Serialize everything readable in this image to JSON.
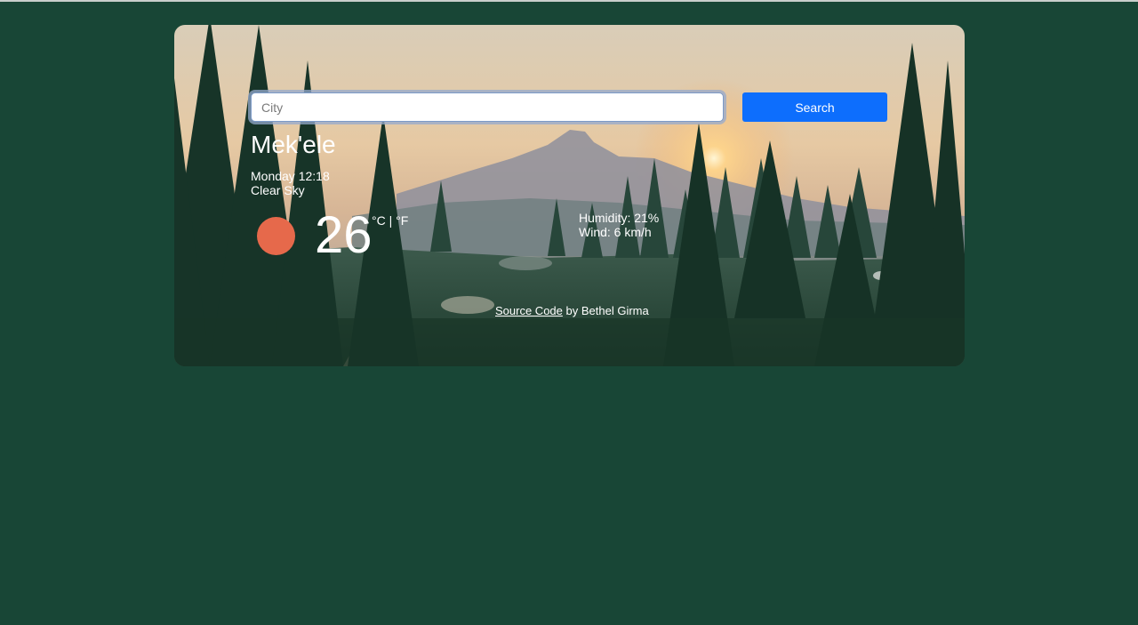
{
  "search": {
    "placeholder": "City",
    "value": "",
    "button_label": "Search"
  },
  "weather": {
    "city": "Mek'ele",
    "date": "Monday 12:18",
    "description": "Clear Sky",
    "icon": "sun-icon",
    "temperature": "26",
    "unit_celsius": "°C",
    "unit_separator": "|",
    "unit_fahrenheit": "°F",
    "humidity": "Humidity: 21%",
    "wind": "Wind: 6 km/h"
  },
  "footer": {
    "link_text": "Source Code",
    "author_text": "by Bethel Girma"
  },
  "colors": {
    "page_background": "#184636",
    "button": "#0d6efd",
    "icon": "#e6694b"
  }
}
